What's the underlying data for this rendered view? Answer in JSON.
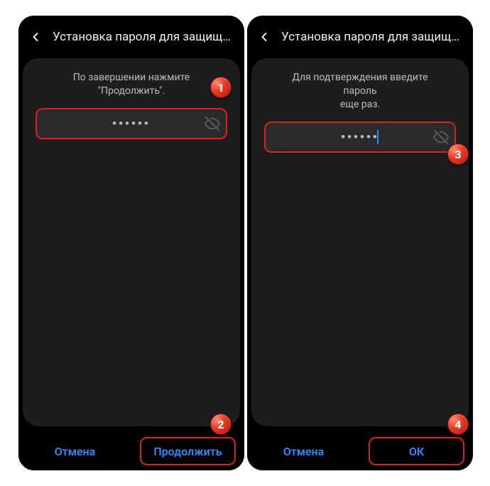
{
  "screens": {
    "left": {
      "title": "Установка пароля для защищен…",
      "instruction": "По завершении нажмите\n\"Продолжить\".",
      "password_mask": "••••••",
      "cancel_label": "Отмена",
      "primary_label": "Продолжить"
    },
    "right": {
      "title": "Установка пароля для защищен…",
      "instruction": "Для подтверждения введите пароль\nеще раз.",
      "password_mask": "••••••",
      "cancel_label": "Отмена",
      "primary_label": "ОК"
    }
  },
  "badges": {
    "b1": "1",
    "b2": "2",
    "b3": "3",
    "b4": "4"
  },
  "icons": {
    "back": "chevron-left-icon",
    "visibility_off": "eye-off-icon"
  },
  "colors": {
    "accent": "#2a8cff",
    "highlight_border": "#d9221f",
    "panel_bg": "#1d1d1d"
  }
}
